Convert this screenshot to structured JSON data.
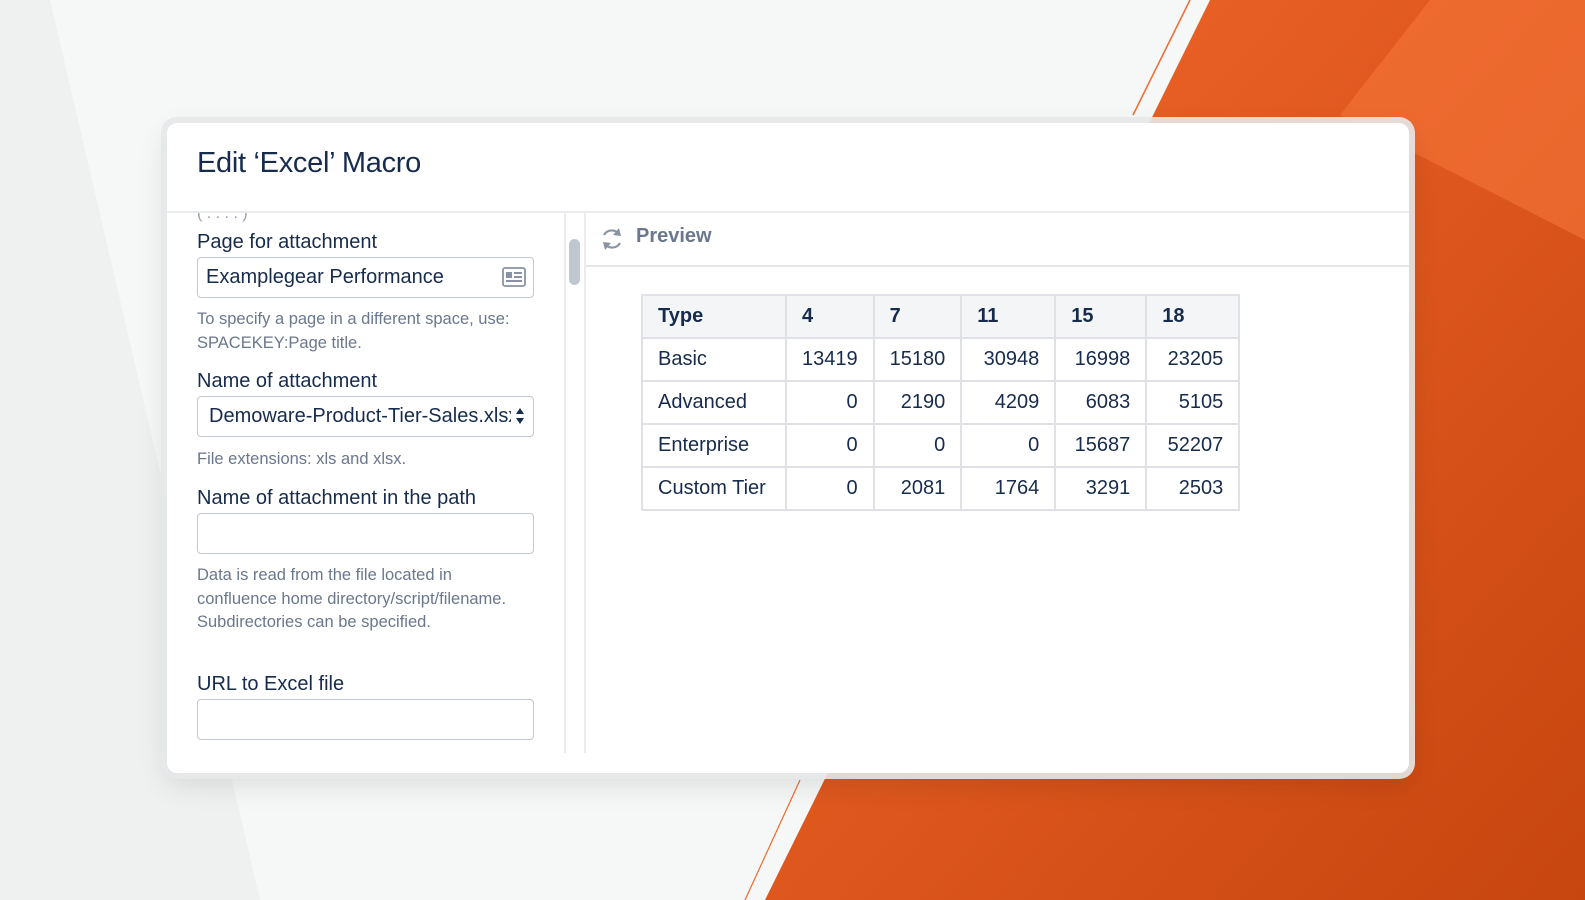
{
  "dialog": {
    "title": "Edit ‘Excel’ Macro"
  },
  "form": {
    "page_for_attachment": {
      "label": "Page for attachment",
      "value": "Examplegear Performance",
      "help": "To specify a page in a different space, use: SPACEKEY:Page title."
    },
    "name_of_attachment": {
      "label": "Name of attachment",
      "value": "Demoware-Product-Tier-Sales.xlsx",
      "help": "File extensions: xls and xlsx."
    },
    "name_in_path": {
      "label": "Name of attachment in the path",
      "value": "",
      "help": "Data is read from the file located in confluence home directory/script/filename. Subdirectories can be specified."
    },
    "url_to_excel": {
      "label": "URL to Excel file",
      "value": ""
    }
  },
  "preview": {
    "label": "Preview",
    "table": {
      "headers": [
        "Type",
        "4",
        "7",
        "11",
        "15",
        "18"
      ],
      "rows": [
        [
          "Basic",
          "13419",
          "15180",
          "30948",
          "16998",
          "23205"
        ],
        [
          "Advanced",
          "0",
          "2190",
          "4209",
          "6083",
          "5105"
        ],
        [
          "Enterprise",
          "0",
          "0",
          "0",
          "15687",
          "52207"
        ],
        [
          "Custom Tier",
          "0",
          "2081",
          "1764",
          "3291",
          "2503"
        ]
      ]
    }
  },
  "icons": {
    "page_picker": "page-picker-icon",
    "select_arrows": "select-arrows-icon",
    "refresh": "refresh-icon"
  },
  "colors": {
    "accent_orange": "#e8612a",
    "title_text": "#172b4d",
    "help_text": "#6b778c"
  }
}
